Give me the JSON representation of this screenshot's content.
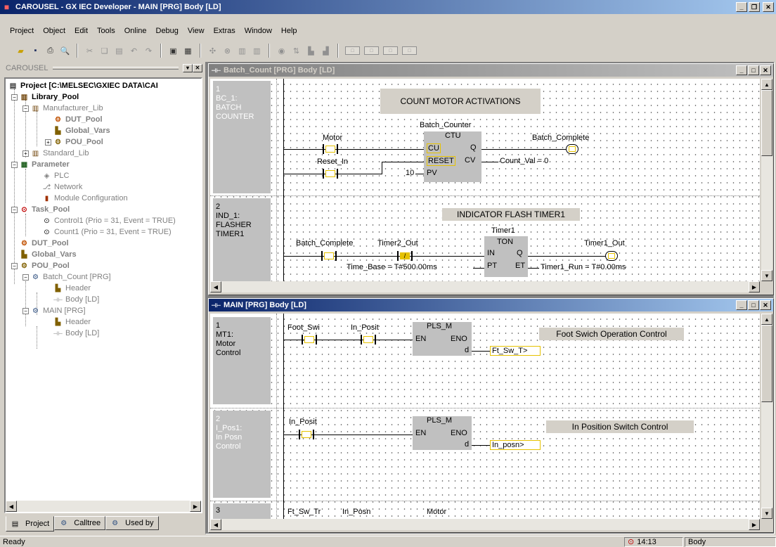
{
  "app": {
    "title": "CAROUSEL - GX IEC Developer - MAIN [PRG] Body [LD]"
  },
  "menu": {
    "items": [
      "Project",
      "Object",
      "Edit",
      "Tools",
      "Online",
      "Debug",
      "View",
      "Extras",
      "Window",
      "Help"
    ]
  },
  "project_panel": {
    "header": "CAROUSEL",
    "tree": {
      "root": "Project [C:\\MELSEC\\GXIEC DATA\\CAI",
      "library_pool": "Library_Pool",
      "manufacturer_lib": "Manufacturer_Lib",
      "dut_pool_lib": "DUT_Pool",
      "global_vars_lib": "Global_Vars",
      "pou_pool_lib": "POU_Pool",
      "standard_lib": "Standard_Lib",
      "parameter": "Parameter",
      "plc": "PLC",
      "network": "Network",
      "module_config": "Module Configuration",
      "task_pool": "Task_Pool",
      "control1": "Control1 (Prio = 31, Event = TRUE)",
      "count1": "Count1 (Prio = 31, Event = TRUE)",
      "dut_pool": "DUT_Pool",
      "global_vars": "Global_Vars",
      "pou_pool": "POU_Pool",
      "batch_count": "Batch_Count [PRG]",
      "batch_header": "Header",
      "batch_body": "Body [LD]",
      "main_prg": "MAIN [PRG]",
      "main_header": "Header",
      "main_body": "Body [LD]"
    },
    "tabs": [
      "Project",
      "Calltree",
      "Used by"
    ]
  },
  "batch_window": {
    "title": "Batch_Count [PRG] Body [LD]",
    "net1": {
      "label_lines": [
        "1",
        "BC_1:",
        "BATCH",
        "COUNTER"
      ],
      "comment": "COUNT MOTOR ACTIVATIONS",
      "instance": "Batch_Counter",
      "block": "CTU",
      "pin_cu": "CU",
      "pin_q": "Q",
      "pin_reset": "RESET",
      "pin_cv": "CV",
      "pin_pv": "PV",
      "contact_motor": "Motor",
      "contact_reset": "Reset_In",
      "pv_value": "10",
      "coil_out": "Batch_Complete",
      "cv_out": "Count_Val = 0"
    },
    "net2": {
      "label_lines": [
        "2",
        "IND_1:",
        "FLASHER",
        "TIMER1"
      ],
      "comment": "INDICATOR FLASH TIMER1",
      "instance": "Timer1",
      "block": "TON",
      "pin_in": "IN",
      "pin_q": "Q",
      "pin_pt": "PT",
      "pin_et": "ET",
      "contact_a": "Batch_Complete",
      "contact_b": "Timer2_Out",
      "pt_value": "Time_Base = T#500.00ms",
      "coil_out": "Timer1_Out",
      "et_out": "Timer1_Run = T#0.00ms"
    }
  },
  "main_window": {
    "title": "MAIN [PRG] Body [LD]",
    "net1": {
      "label_lines": [
        "1",
        "MT1:",
        "Motor",
        "Control"
      ],
      "contact_a": "Foot_Swi",
      "contact_b": "In_Posit",
      "block": "PLS_M",
      "pin_en": "EN",
      "pin_eno": "ENO",
      "pin_d": "d",
      "out": "Ft_Sw_T>",
      "comment": "Foot Swich Operation Control"
    },
    "net2": {
      "label_lines": [
        "2",
        "I_Pos1:",
        "In Posn",
        "Control"
      ],
      "contact_a": "In_Posit",
      "block": "PLS_M",
      "pin_en": "EN",
      "pin_eno": "ENO",
      "pin_d": "d",
      "out": "In_posn>",
      "comment": "In Position Switch Control"
    },
    "net3": {
      "label_lines": [
        "3"
      ],
      "contact_a": "Ft_Sw_Tr",
      "contact_b": "In_Posn",
      "contact_c": "Motor"
    }
  },
  "status": {
    "left": "Ready",
    "time": "14:13",
    "mode": "Body"
  }
}
